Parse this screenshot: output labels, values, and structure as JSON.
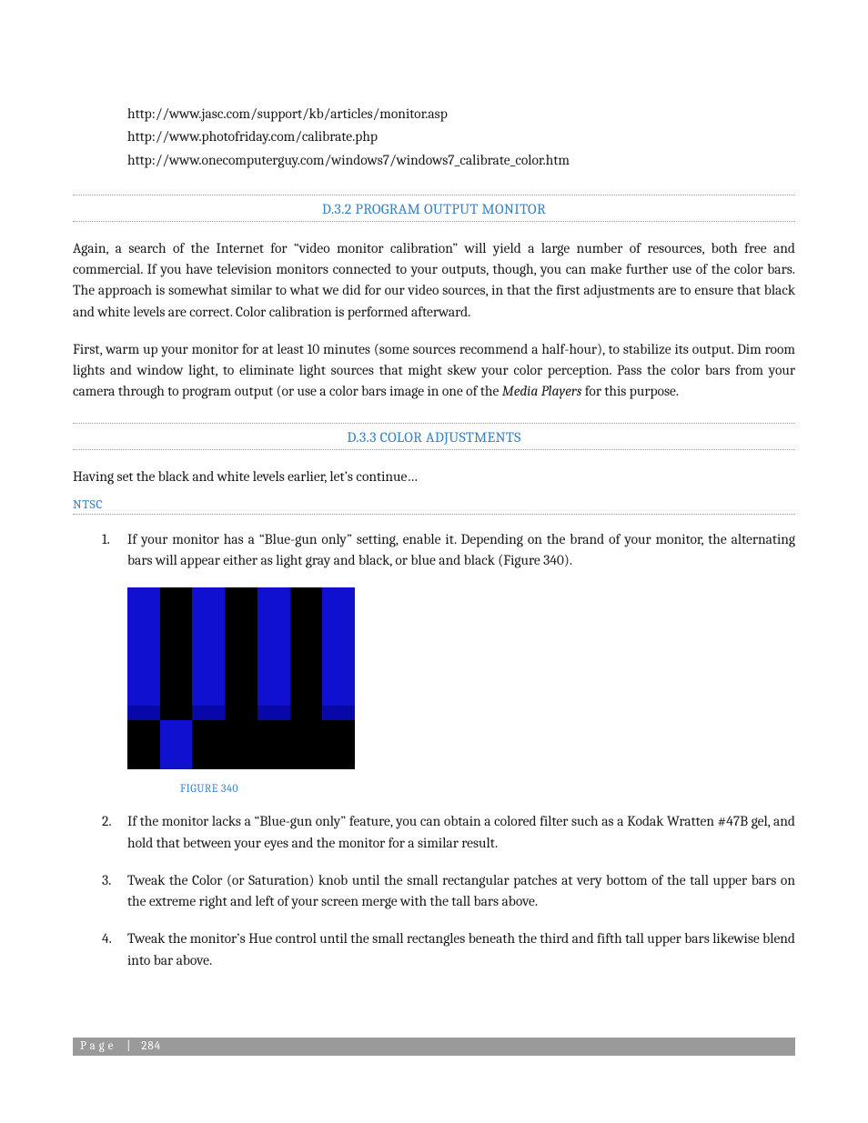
{
  "urls": {
    "u1": "http://www.jasc.com/support/kb/articles/monitor.asp",
    "u2": "http://www.photofriday.com/calibrate.php",
    "u3": "http://www.onecomputerguy.com/windows7/windows7_calibrate_color.htm"
  },
  "headings": {
    "s1": "D.3.2 PROGRAM OUTPUT MONITOR",
    "s2": "D.3.3 COLOR ADJUSTMENTS",
    "sub_ntsc": "NTSC"
  },
  "paragraphs": {
    "p1": "Again, a search of the Internet for “video monitor calibration” will yield a large number of resources, both free and commercial.  If you have television monitors connected to your outputs, though, you can make further use of the color bars.  The approach is somewhat similar to what we did for our video sources, in that the first adjustments are to ensure that black and white levels are correct.  Color calibration is performed afterward.",
    "p2a": "First, warm up your monitor for at least 10 minutes (some sources recommend a half-hour), to stabilize its output.  Dim room lights and window light, to eliminate light sources that might skew your color perception.  Pass the color bars from your camera through to program output (or use a color bars image in one of the ",
    "p2_italic": "Media Players",
    "p2b": " for this purpose.",
    "p3": "Having set the black and white levels earlier, let’s continue…"
  },
  "list": {
    "i1": "If your monitor has a “Blue-gun only” setting, enable it.  Depending on the brand of your monitor, the alternating bars will appear either as light gray and black, or blue and black (Figure 340).",
    "i2": "If the monitor lacks a “Blue-gun only” feature, you can obtain a colored filter such as a Kodak Wratten #47B gel, and hold that between your eyes and the monitor for a similar result.",
    "i3a": "Tweak the ",
    "i3_italic1": "Color",
    "i3b": " (or ",
    "i3_italic2": "Saturation",
    "i3c": ") knob until the small rectangular patches at very bottom of the tall upper bars on the extreme right and left of your screen merge with the tall bars above.",
    "i4a": "Tweak the monitor’s ",
    "i4_italic": "Hue",
    "i4b": " control until the small rectangles beneath the third and fifth tall upper bars likewise blend into bar above."
  },
  "figure": {
    "caption": "FIGURE 340"
  },
  "footer": {
    "label": "Page",
    "sep": "|",
    "num": "284"
  }
}
